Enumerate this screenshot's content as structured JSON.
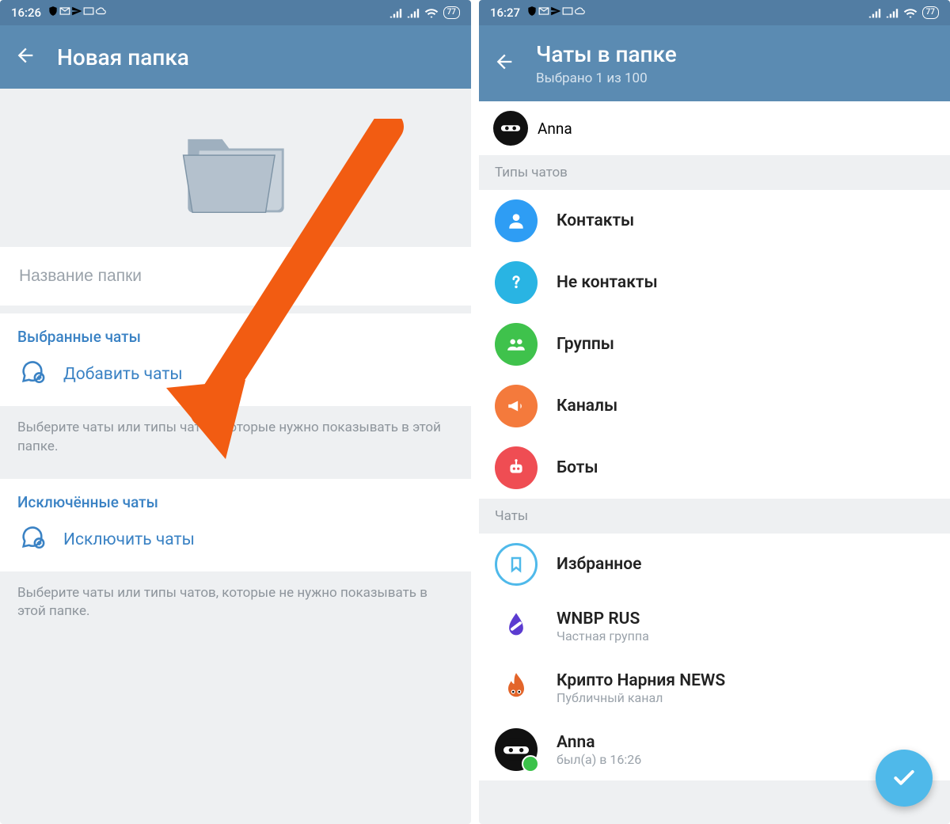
{
  "left": {
    "status": {
      "time": "16:26",
      "battery": "77"
    },
    "header": {
      "title": "Новая папка"
    },
    "folder_name_placeholder": "Название папки",
    "included": {
      "title": "Выбранные чаты",
      "action": "Добавить чаты",
      "helper": "Выберите чаты или типы чатов, которые нужно показывать в этой папке."
    },
    "excluded": {
      "title": "Исключённые чаты",
      "action": "Исключить чаты",
      "helper": "Выберите чаты или типы чатов, которые не нужно показывать в этой папке."
    }
  },
  "right": {
    "status": {
      "time": "16:27",
      "battery": "77"
    },
    "header": {
      "title": "Чаты в папке",
      "subtitle": "Выбрано 1 из 100"
    },
    "selected_chip": {
      "name": "Anna"
    },
    "section_types": "Типы чатов",
    "types": [
      {
        "id": "contacts",
        "label": "Контакты",
        "color": "#2e9df4",
        "icon": "person"
      },
      {
        "id": "non-contacts",
        "label": "Не контакты",
        "color": "#29b4e3",
        "icon": "question"
      },
      {
        "id": "groups",
        "label": "Группы",
        "color": "#3fc24c",
        "icon": "group"
      },
      {
        "id": "channels",
        "label": "Каналы",
        "color": "#f47a3c",
        "icon": "megaphone"
      },
      {
        "id": "bots",
        "label": "Боты",
        "color": "#ef4d53",
        "icon": "bot"
      }
    ],
    "section_chats": "Чаты",
    "chats": [
      {
        "name": "Избранное",
        "subtitle": "",
        "icon": "bookmark-ring"
      },
      {
        "name": "WNBP RUS",
        "subtitle": "Частная группа",
        "icon": "drop"
      },
      {
        "name": "Крипто Нарния NEWS",
        "subtitle": "Публичный канал",
        "icon": "flame"
      },
      {
        "name": "Anna",
        "subtitle": "был(а) в 16:26",
        "icon": "anna",
        "online": true
      }
    ]
  },
  "overlay": {
    "arrow_color": "#f25c12"
  }
}
